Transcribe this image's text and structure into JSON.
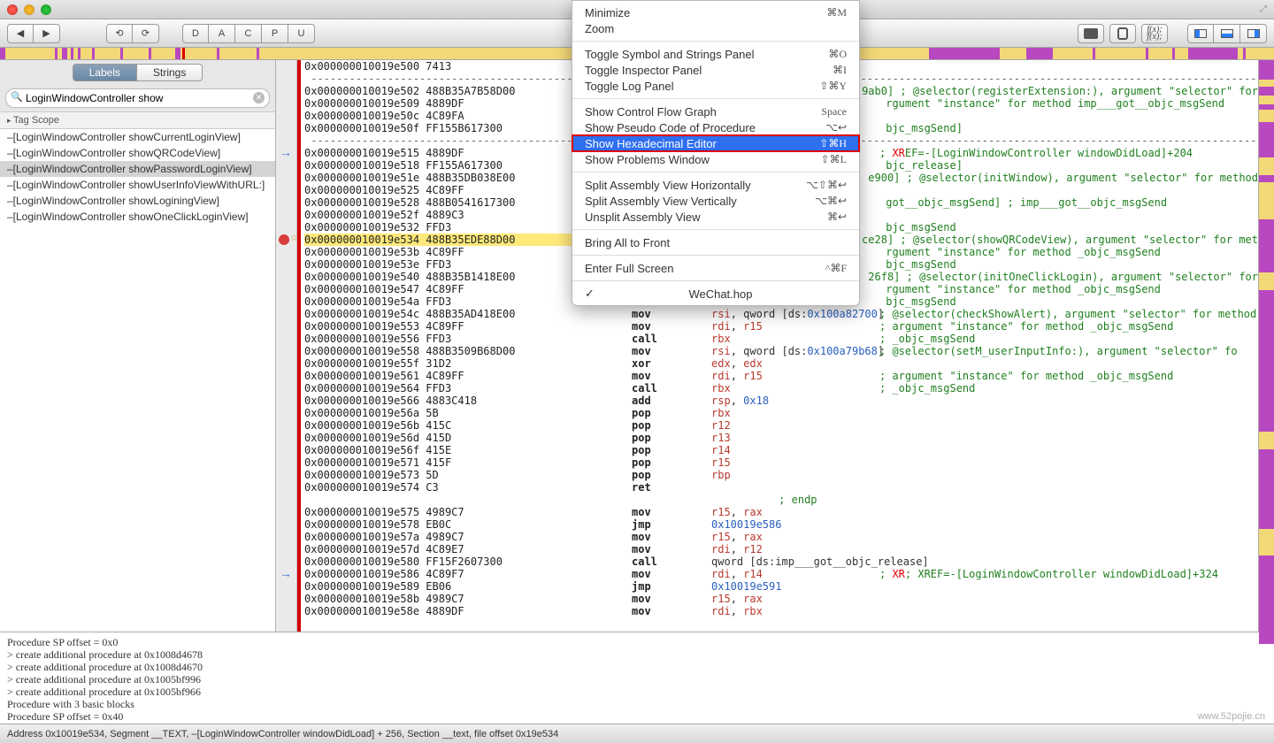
{
  "titlebar": {
    "doc": ""
  },
  "toolbar": {
    "nav": [
      "◀",
      "▶"
    ],
    "reload": [
      "⟲",
      "⟳"
    ],
    "regs": [
      "D",
      "A",
      "C",
      "P",
      "U"
    ]
  },
  "sidebar": {
    "tabs": {
      "labels": "Labels",
      "strings": "Strings"
    },
    "search": {
      "value": "LoginWindowController show"
    },
    "tagscope": "Tag Scope",
    "rows": [
      "–[LoginWindowController showCurrentLoginView]",
      "–[LoginWindowController showQRCodeView]",
      "–[LoginWindowController showPasswordLoginView]",
      "–[LoginWindowController showUserInfoViewWithURL:]",
      "–[LoginWindowController showLoginingView]",
      "–[LoginWindowController showOneClickLoginView]"
    ],
    "selected_index": 2
  },
  "code": {
    "lines": [
      {
        "addr": "0x000000010019e500",
        "bytes": "7413",
        "mnem": "",
        "ops": "",
        "cmt": ""
      },
      {
        "sep": true
      },
      {
        "addr": "0x000000010019e502",
        "bytes": "488B35A7B58D00",
        "mnem": "",
        "ops": "",
        "cmt": "9ab0] ; @selector(registerExtension:), argument \"selector\" for"
      },
      {
        "addr": "0x000000010019e509",
        "bytes": "4889DF",
        "mnem": "",
        "ops": "",
        "cmt": "rgument \"instance\" for method imp___got__objc_msgSend"
      },
      {
        "addr": "0x000000010019e50c",
        "bytes": "4C89FA",
        "mnem": "",
        "ops": "",
        "cmt": ""
      },
      {
        "addr": "0x000000010019e50f",
        "bytes": "FF155B617300",
        "mnem": "",
        "ops": "",
        "cmt": "bjc_msgSend]"
      },
      {
        "sep": true
      },
      {
        "addr": "0x000000010019e515",
        "bytes": "4889DF",
        "mnem": "",
        "ops": "",
        "cmt": "EF=-[LoginWindowController windowDidLoad]+204",
        "xref": true,
        "arrow": true
      },
      {
        "addr": "0x000000010019e518",
        "bytes": "FF155A617300",
        "mnem": "",
        "ops": "",
        "cmt": "bjc_release]"
      },
      {
        "addr": "0x000000010019e51e",
        "bytes": "488B35DB038E00",
        "mnem": "",
        "ops": "",
        "cmt": "e900] ; @selector(initWindow), argument \"selector\" for method"
      },
      {
        "addr": "0x000000010019e525",
        "bytes": "4C89FF",
        "mnem": "",
        "ops": "",
        "cmt": ""
      },
      {
        "addr": "0x000000010019e528",
        "bytes": "488B0541617300",
        "mnem": "",
        "ops": "",
        "cmt": "got__objc_msgSend] ; imp___got__objc_msgSend"
      },
      {
        "addr": "0x000000010019e52f",
        "bytes": "4889C3",
        "mnem": "",
        "ops": "",
        "cmt": ""
      },
      {
        "addr": "0x000000010019e532",
        "bytes": "FFD3",
        "mnem": "",
        "ops": "",
        "cmt": "bjc_msgSend"
      },
      {
        "addr": "0x000000010019e534",
        "bytes": "488B35EDE88D00",
        "mnem": "",
        "ops": "",
        "cmt": "ce28] ; @selector(showQRCodeView), argument \"selector\" for met",
        "bp": true,
        "star": true,
        "hl": true,
        "arrow": true
      },
      {
        "addr": "0x000000010019e53b",
        "bytes": "4C89FF",
        "mnem": "",
        "ops": "",
        "cmt": "rgument \"instance\" for method _objc_msgSend"
      },
      {
        "addr": "0x000000010019e53e",
        "bytes": "FFD3",
        "mnem": "",
        "ops": "",
        "cmt": "bjc_msgSend"
      },
      {
        "addr": "0x000000010019e540",
        "bytes": "488B35B1418E00",
        "mnem": "",
        "ops": "",
        "cmt": "26f8] ; @selector(initOneClickLogin), argument \"selector\" for"
      },
      {
        "addr": "0x000000010019e547",
        "bytes": "4C89FF",
        "mnem": "",
        "ops": "",
        "cmt": "rgument \"instance\" for method _objc_msgSend"
      },
      {
        "addr": "0x000000010019e54a",
        "bytes": "FFD3",
        "mnem": "",
        "ops": "",
        "cmt": "bjc_msgSend"
      },
      {
        "addr": "0x000000010019e54c",
        "bytes": "488B35AD418E00",
        "mnem": "mov",
        "ops": "rsi, qword [ds:0x100a82700]",
        "cmt": "; @selector(checkShowAlert), argument \"selector\" for method"
      },
      {
        "addr": "0x000000010019e553",
        "bytes": "4C89FF",
        "mnem": "mov",
        "ops": "rdi, r15",
        "cmt": "; argument \"instance\" for method _objc_msgSend"
      },
      {
        "addr": "0x000000010019e556",
        "bytes": "FFD3",
        "mnem": "call",
        "ops": "rbx",
        "cmt": "; _objc_msgSend"
      },
      {
        "addr": "0x000000010019e558",
        "bytes": "488B3509B68D00",
        "mnem": "mov",
        "ops": "rsi, qword [ds:0x100a79b68]",
        "cmt": "; @selector(setM_userInputInfo:), argument \"selector\" fo"
      },
      {
        "addr": "0x000000010019e55f",
        "bytes": "31D2",
        "mnem": "xor",
        "ops": "edx, edx",
        "cmt": ""
      },
      {
        "addr": "0x000000010019e561",
        "bytes": "4C89FF",
        "mnem": "mov",
        "ops": "rdi, r15",
        "cmt": "; argument \"instance\" for method _objc_msgSend"
      },
      {
        "addr": "0x000000010019e564",
        "bytes": "FFD3",
        "mnem": "call",
        "ops": "rbx",
        "cmt": "; _objc_msgSend"
      },
      {
        "addr": "0x000000010019e566",
        "bytes": "4883C418",
        "mnem": "add",
        "ops": "rsp, 0x18",
        "cmt": ""
      },
      {
        "addr": "0x000000010019e56a",
        "bytes": "5B",
        "mnem": "pop",
        "ops": "rbx",
        "cmt": ""
      },
      {
        "addr": "0x000000010019e56b",
        "bytes": "415C",
        "mnem": "pop",
        "ops": "r12",
        "cmt": ""
      },
      {
        "addr": "0x000000010019e56d",
        "bytes": "415D",
        "mnem": "pop",
        "ops": "r13",
        "cmt": ""
      },
      {
        "addr": "0x000000010019e56f",
        "bytes": "415E",
        "mnem": "pop",
        "ops": "r14",
        "cmt": ""
      },
      {
        "addr": "0x000000010019e571",
        "bytes": "415F",
        "mnem": "pop",
        "ops": "r15",
        "cmt": ""
      },
      {
        "addr": "0x000000010019e573",
        "bytes": "5D",
        "mnem": "pop",
        "ops": "rbp",
        "cmt": ""
      },
      {
        "addr": "0x000000010019e574",
        "bytes": "C3",
        "mnem": "ret",
        "ops": "",
        "cmt": ""
      },
      {
        "endp": true,
        "text": "; endp"
      },
      {
        "addr": "0x000000010019e575",
        "bytes": "4989C7",
        "mnem": "mov",
        "ops": "r15, rax",
        "cmt": ""
      },
      {
        "addr": "0x000000010019e578",
        "bytes": "EB0C",
        "mnem": "jmp",
        "ops": "0x10019e586",
        "cmt": ""
      },
      {
        "addr": "0x000000010019e57a",
        "bytes": "4989C7",
        "mnem": "mov",
        "ops": "r15, rax",
        "cmt": ""
      },
      {
        "addr": "0x000000010019e57d",
        "bytes": "4C89E7",
        "mnem": "mov",
        "ops": "rdi, r12",
        "cmt": ""
      },
      {
        "addr": "0x000000010019e580",
        "bytes": "FF15F2607300",
        "mnem": "call",
        "ops": "qword [ds:imp___got__objc_release]",
        "cmt": ""
      },
      {
        "addr": "0x000000010019e586",
        "bytes": "4C89F7",
        "mnem": "mov",
        "ops": "rdi, r14",
        "cmt": "; XREF=-[LoginWindowController windowDidLoad]+324",
        "xref": true,
        "arrow": true
      },
      {
        "addr": "0x000000010019e589",
        "bytes": "EB06",
        "mnem": "jmp",
        "ops": "0x10019e591",
        "cmt": ""
      },
      {
        "addr": "0x000000010019e58b",
        "bytes": "4989C7",
        "mnem": "mov",
        "ops": "r15, rax",
        "cmt": ""
      },
      {
        "addr": "0x000000010019e58e",
        "bytes": "4889DF",
        "mnem": "mov",
        "ops": "rdi, rbx",
        "cmt": ""
      }
    ]
  },
  "menu": {
    "items": [
      {
        "label": "Minimize",
        "sc": "⌘M"
      },
      {
        "label": "Zoom",
        "sc": ""
      },
      {
        "sep": true
      },
      {
        "label": "Toggle Symbol and Strings Panel",
        "sc": "⌘O"
      },
      {
        "label": "Toggle Inspector Panel",
        "sc": "⌘I"
      },
      {
        "label": "Toggle Log Panel",
        "sc": "⇧⌘Y"
      },
      {
        "sep": true
      },
      {
        "label": "Show Control Flow Graph",
        "sc": "Space"
      },
      {
        "label": "Show Pseudo Code of Procedure",
        "sc": "⌥↩"
      },
      {
        "label": "Show Hexadecimal Editor",
        "sc": "⇧⌘H",
        "sel": true
      },
      {
        "label": "Show Problems Window",
        "sc": "⇧⌘L"
      },
      {
        "sep": true
      },
      {
        "label": "Split Assembly View Horizontally",
        "sc": "⌥⇧⌘↩"
      },
      {
        "label": "Split Assembly View Vertically",
        "sc": "⌥⌘↩"
      },
      {
        "label": "Unsplit Assembly View",
        "sc": "⌘↩"
      },
      {
        "sep": true
      },
      {
        "label": "Bring All to Front",
        "sc": ""
      },
      {
        "sep": true
      },
      {
        "label": "Enter Full Screen",
        "sc": "^⌘F"
      },
      {
        "sep": true
      },
      {
        "label": "WeChat.hop",
        "sc": "",
        "chk": true
      }
    ]
  },
  "log": [
    "Procedure SP offset = 0x0",
    "> create additional procedure at 0x1008d4678",
    "> create additional procedure at 0x1008d4670",
    "> create additional procedure at 0x1005bf996",
    "> create additional procedure at 0x1005bf966",
    "Procedure with 3 basic blocks",
    "Procedure SP offset = 0x40"
  ],
  "status": "Address 0x10019e534, Segment __TEXT, –[LoginWindowController windowDidLoad] + 256, Section __text, file offset 0x19e534",
  "watermark": "www.52pojie.cn"
}
